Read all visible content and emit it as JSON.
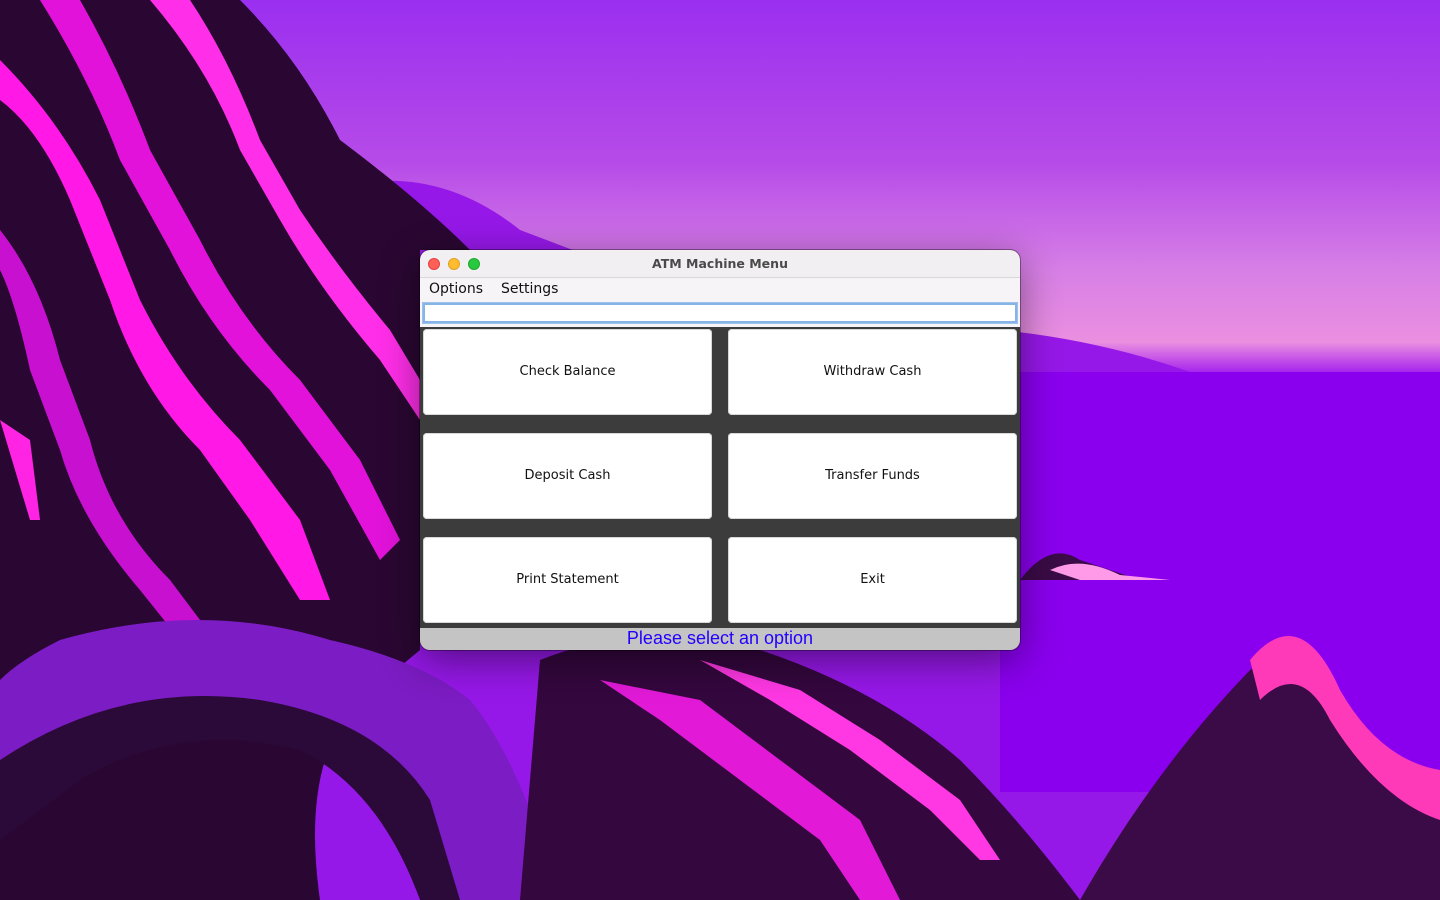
{
  "window": {
    "title": "ATM Machine Menu"
  },
  "menubar": {
    "items": [
      {
        "label": "Options"
      },
      {
        "label": "Settings"
      }
    ]
  },
  "input": {
    "value": "",
    "placeholder": ""
  },
  "buttons": [
    {
      "label": "Check Balance"
    },
    {
      "label": "Withdraw Cash"
    },
    {
      "label": "Deposit Cash"
    },
    {
      "label": "Transfer Funds"
    },
    {
      "label": "Print Statement"
    },
    {
      "label": "Exit"
    }
  ],
  "status": {
    "message": "Please select an option",
    "color": "#2200ff"
  },
  "colors": {
    "close": "#fe5f57",
    "minimize": "#febc2e",
    "maximize": "#28c840",
    "grid_background": "#3c3c3c",
    "status_background": "#c4c4c4"
  }
}
